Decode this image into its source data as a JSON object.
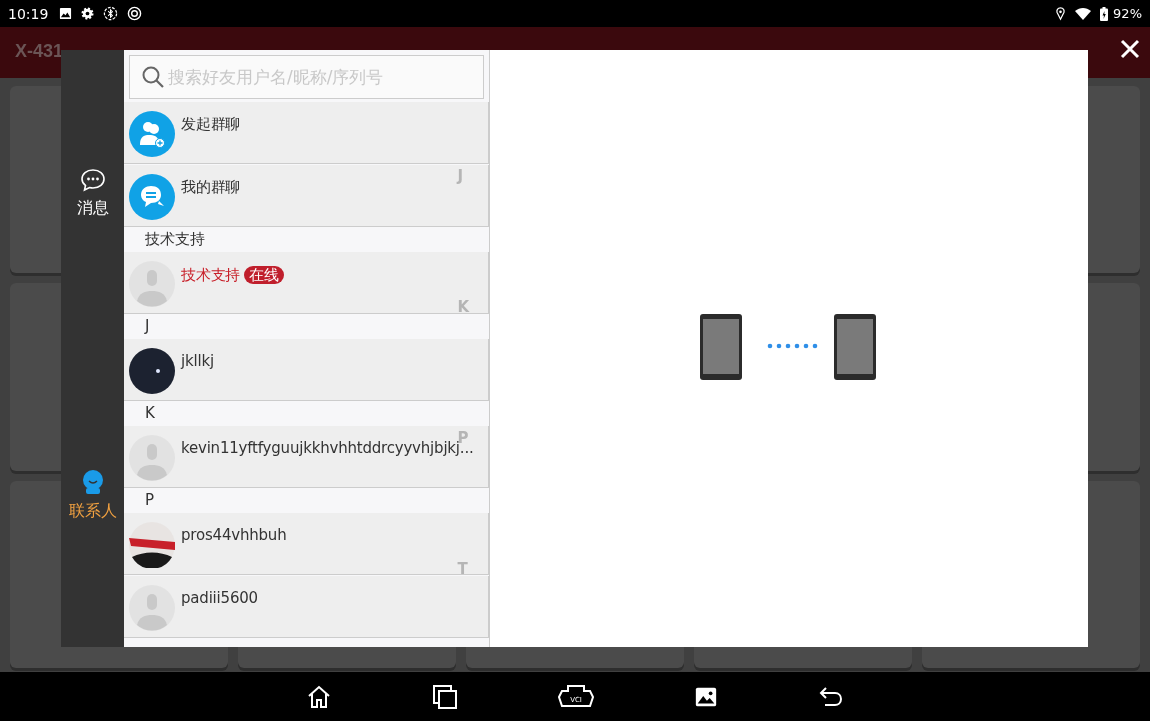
{
  "status_bar": {
    "time": "10:19",
    "battery": "92%"
  },
  "app_header": {
    "title": "X-431"
  },
  "sidebar": {
    "items": [
      {
        "label": "消息",
        "kind": "messages",
        "selected": false
      },
      {
        "label": "联系人",
        "kind": "contacts",
        "selected": true
      }
    ]
  },
  "search": {
    "placeholder": "搜索好友用户名/昵称/序列号"
  },
  "contacts": [
    {
      "kind": "action",
      "avatar": {
        "kind": "group-add"
      },
      "name": "发起群聊"
    },
    {
      "kind": "action",
      "avatar": {
        "kind": "group-chat"
      },
      "name": "我的群聊"
    },
    {
      "kind": "header",
      "name": "技术支持"
    },
    {
      "kind": "contact",
      "avatar": {
        "kind": "default"
      },
      "name": "技术支持",
      "highlight": true,
      "badge": "在线"
    },
    {
      "kind": "header",
      "name": "J"
    },
    {
      "kind": "contact",
      "avatar": {
        "kind": "photo-dark"
      },
      "name": "jkllkj",
      "highlight": false
    },
    {
      "kind": "header",
      "name": "K"
    },
    {
      "kind": "contact",
      "avatar": {
        "kind": "default"
      },
      "name": "kevin11yftfyguujkkhvhhtddrcyyvhjbjkj...",
      "highlight": false
    },
    {
      "kind": "header",
      "name": "P"
    },
    {
      "kind": "contact",
      "avatar": {
        "kind": "photo-car"
      },
      "name": "pros44vhhbuh",
      "highlight": false
    },
    {
      "kind": "contact",
      "avatar": {
        "kind": "default"
      },
      "name": "padiii5600",
      "highlight": false
    }
  ],
  "index_letters": [
    "J",
    "K",
    "P",
    "T"
  ],
  "nav_bar": {
    "vci_label": "VCI"
  }
}
